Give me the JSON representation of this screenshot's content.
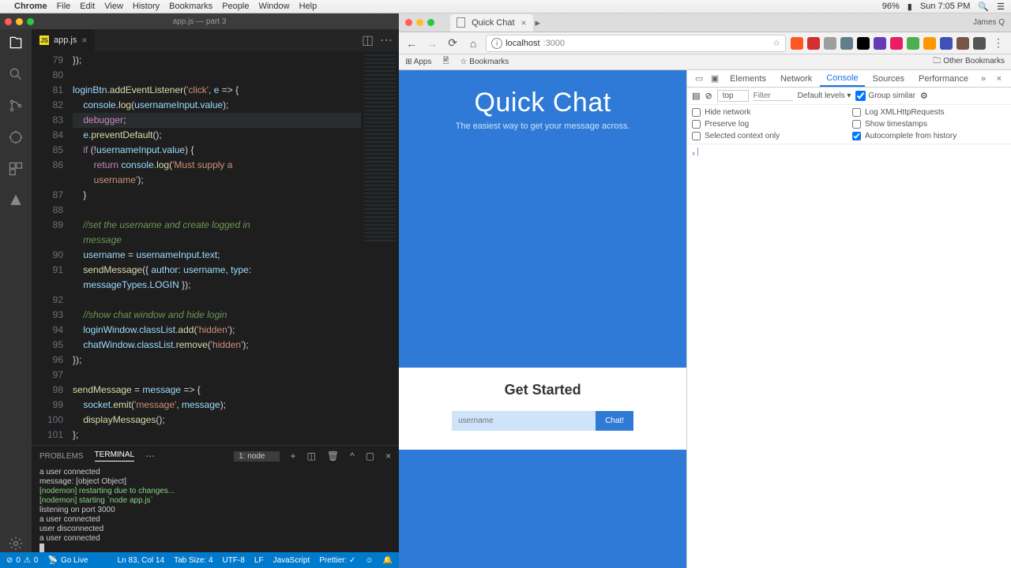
{
  "mac": {
    "app": "Chrome",
    "menus": [
      "File",
      "Edit",
      "View",
      "History",
      "Bookmarks",
      "People",
      "Window",
      "Help"
    ],
    "battery": "96%",
    "clock": "Sun 7:05 PM"
  },
  "vscode": {
    "window_title": "app.js — part 3",
    "tab": {
      "icon": "JS",
      "name": "app.js"
    },
    "gutter_start": 79,
    "lines": [
      {
        "n": 79,
        "html": "<span class='tk-pun'>});</span>"
      },
      {
        "n": 80,
        "html": ""
      },
      {
        "n": 81,
        "html": "<span class='tk-var'>loginBtn</span><span class='tk-pun'>.</span><span class='tk-fn'>addEventListener</span><span class='tk-pun'>(</span><span class='tk-str'>'click'</span><span class='tk-pun'>, </span><span class='tk-var'>e</span><span class='tk-pun'> =&gt; {</span>"
      },
      {
        "n": 82,
        "html": "    <span class='tk-var'>console</span><span class='tk-pun'>.</span><span class='tk-fn'>log</span><span class='tk-pun'>(</span><span class='tk-var'>usernameInput</span><span class='tk-pun'>.</span><span class='tk-prop'>value</span><span class='tk-pun'>);</span>"
      },
      {
        "n": 83,
        "cur": true,
        "html": "    <span class='tk-kw'>debugger</span><span class='tk-pun'>;</span>"
      },
      {
        "n": 84,
        "html": "    <span class='tk-var'>e</span><span class='tk-pun'>.</span><span class='tk-fn'>preventDefault</span><span class='tk-pun'>();</span>"
      },
      {
        "n": 85,
        "html": "    <span class='tk-kw'>if</span><span class='tk-pun'> (!</span><span class='tk-var'>usernameInput</span><span class='tk-pun'>.</span><span class='tk-prop'>value</span><span class='tk-pun'>) {</span>"
      },
      {
        "n": 86,
        "html": "        <span class='tk-kw'>return</span> <span class='tk-var'>console</span><span class='tk-pun'>.</span><span class='tk-fn'>log</span><span class='tk-pun'>(</span><span class='tk-str'>'Must supply a </span>"
      },
      {
        "n": 0,
        "html": "        <span class='tk-str'>username'</span><span class='tk-pun'>);</span>"
      },
      {
        "n": 87,
        "html": "    <span class='tk-pun'>}</span>"
      },
      {
        "n": 88,
        "html": ""
      },
      {
        "n": 89,
        "html": "    <span class='tk-com'>//set the username and create logged in </span>"
      },
      {
        "n": 0,
        "html": "    <span class='tk-com'>message</span>"
      },
      {
        "n": 90,
        "html": "    <span class='tk-var'>username</span><span class='tk-pun'> = </span><span class='tk-var'>usernameInput</span><span class='tk-pun'>.</span><span class='tk-prop'>text</span><span class='tk-pun'>;</span>"
      },
      {
        "n": 91,
        "html": "    <span class='tk-fn'>sendMessage</span><span class='tk-pun'>({ </span><span class='tk-prop'>author</span><span class='tk-pun'>: </span><span class='tk-var'>username</span><span class='tk-pun'>, </span><span class='tk-prop'>type</span><span class='tk-pun'>: </span>"
      },
      {
        "n": 0,
        "html": "    <span class='tk-var'>messageTypes</span><span class='tk-pun'>.</span><span class='tk-prop'>LOGIN</span><span class='tk-pun'> });</span>"
      },
      {
        "n": 92,
        "html": ""
      },
      {
        "n": 93,
        "html": "    <span class='tk-com'>//show chat window and hide login</span>"
      },
      {
        "n": 94,
        "html": "    <span class='tk-var'>loginWindow</span><span class='tk-pun'>.</span><span class='tk-prop'>classList</span><span class='tk-pun'>.</span><span class='tk-fn'>add</span><span class='tk-pun'>(</span><span class='tk-str'>'hidden'</span><span class='tk-pun'>);</span>"
      },
      {
        "n": 95,
        "html": "    <span class='tk-var'>chatWindow</span><span class='tk-pun'>.</span><span class='tk-prop'>classList</span><span class='tk-pun'>.</span><span class='tk-fn'>remove</span><span class='tk-pun'>(</span><span class='tk-str'>'hidden'</span><span class='tk-pun'>);</span>"
      },
      {
        "n": 96,
        "html": "<span class='tk-pun'>});</span>"
      },
      {
        "n": 97,
        "html": ""
      },
      {
        "n": 98,
        "html": "<span class='tk-fn'>sendMessage</span><span class='tk-pun'> = </span><span class='tk-var'>message</span><span class='tk-pun'> =&gt; {</span>"
      },
      {
        "n": 99,
        "html": "    <span class='tk-var'>socket</span><span class='tk-pun'>.</span><span class='tk-fn'>emit</span><span class='tk-pun'>(</span><span class='tk-str'>'message'</span><span class='tk-pun'>, </span><span class='tk-var'>message</span><span class='tk-pun'>);</span>"
      },
      {
        "n": 100,
        "html": "    <span class='tk-fn'>displayMessages</span><span class='tk-pun'>();</span>"
      },
      {
        "n": 101,
        "html": "<span class='tk-pun'>};</span>"
      }
    ],
    "panel": {
      "tabs": [
        "PROBLEMS",
        "TERMINAL"
      ],
      "active_tab": "TERMINAL",
      "dropdown": "1: node",
      "terminal_lines": [
        {
          "t": "a user connected",
          "c": ""
        },
        {
          "t": "message: [object Object]",
          "c": ""
        },
        {
          "t": "[nodemon] restarting due to changes...",
          "c": "g"
        },
        {
          "t": "[nodemon] starting `node app.js`",
          "c": "g"
        },
        {
          "t": "listening on port 3000",
          "c": ""
        },
        {
          "t": "a user connected",
          "c": ""
        },
        {
          "t": "user disconnected",
          "c": ""
        },
        {
          "t": "a user connected",
          "c": ""
        }
      ]
    },
    "status": {
      "errors": "0",
      "warnings": "0",
      "golive": "Go Live",
      "cursor": "Ln 83, Col 14",
      "tabsize": "Tab Size: 4",
      "encoding": "UTF-8",
      "eol": "LF",
      "lang": "JavaScript",
      "prettier": "Prettier: ✓"
    }
  },
  "chrome": {
    "tab_title": "Quick Chat",
    "user": "James Q",
    "url_host": "localhost",
    "url_path": ":3000",
    "bookmarks": {
      "apps": "Apps",
      "bookmarks": "Bookmarks",
      "other": "Other Bookmarks"
    },
    "ext_colors": [
      "#ff5722",
      "#d32f2f",
      "#9e9e9e",
      "#607d8b",
      "#000",
      "#673ab7",
      "#e91e63",
      "#4caf50",
      "#ff9800",
      "#3f51b5",
      "#795548",
      "#555"
    ]
  },
  "app": {
    "title": "Quick Chat",
    "subtitle": "The easiest way to get your message across.",
    "card_title": "Get Started",
    "placeholder": "username",
    "button": "Chat!"
  },
  "devtools": {
    "tabs": [
      "Elements",
      "Network",
      "Console",
      "Sources",
      "Performance"
    ],
    "active": "Console",
    "context": "top",
    "filter_placeholder": "Filter",
    "levels": "Default levels ▾",
    "group": "Group similar",
    "checks": {
      "hide_network": "Hide network",
      "log_xhr": "Log XMLHttpRequests",
      "preserve": "Preserve log",
      "timestamps": "Show timestamps",
      "selected_ctx": "Selected context only",
      "autocomplete": "Autocomplete from history"
    }
  }
}
